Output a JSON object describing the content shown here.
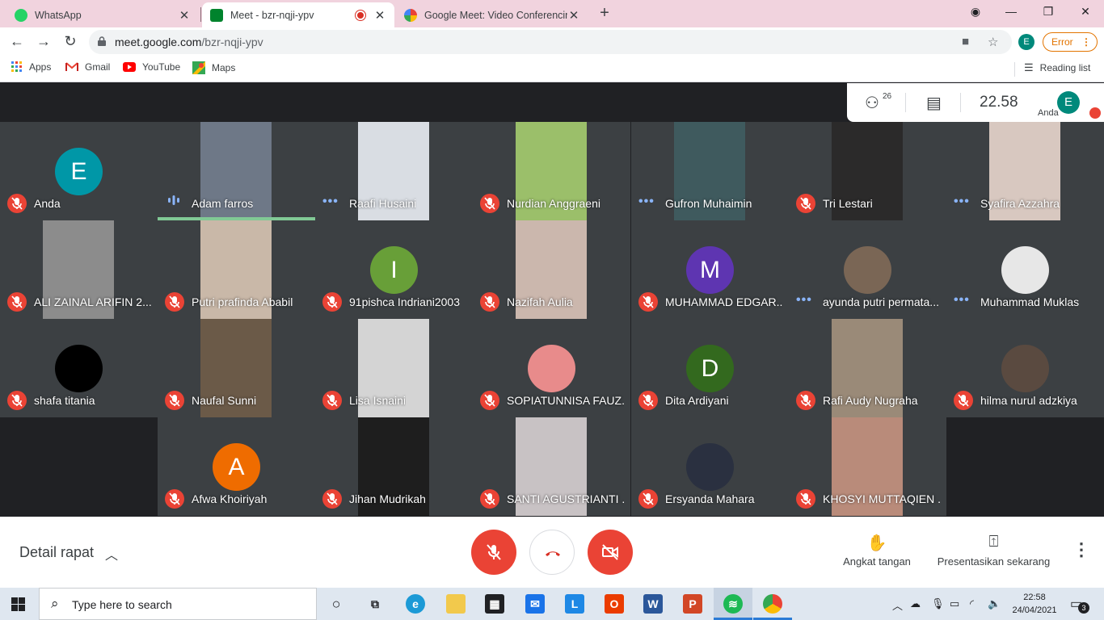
{
  "browser": {
    "tabs": [
      {
        "title": "WhatsApp",
        "favicon": "whatsapp-icon",
        "active": false
      },
      {
        "title": "Meet - bzr-nqji-ypv",
        "favicon": "google-meet-icon",
        "active": true
      },
      {
        "title": "Google Meet: Video Conferencin",
        "favicon": "google-icon",
        "active": false
      }
    ],
    "url_host": "meet.google.com",
    "url_path": "/bzr-nqji-ypv",
    "profile_initial": "E",
    "error_label": "Error",
    "bookmarks": [
      {
        "label": "Apps",
        "icon": "apps-grid-icon"
      },
      {
        "label": "Gmail",
        "icon": "gmail-icon"
      },
      {
        "label": "YouTube",
        "icon": "youtube-icon"
      },
      {
        "label": "Maps",
        "icon": "maps-icon"
      }
    ],
    "reading_list_label": "Reading list"
  },
  "meet": {
    "participant_count": "26",
    "time": "22.58",
    "self_name": "Anda",
    "self_initial": "E",
    "participants": [
      {
        "name": "Anda",
        "status": "muted",
        "avatar": {
          "initial": "E",
          "color": "#0097a7"
        }
      },
      {
        "name": "Adam farros",
        "status": "speaking",
        "video": "#6e7887"
      },
      {
        "name": "Raafi Husaini",
        "status": "active",
        "video": "#d9dde3"
      },
      {
        "name": "Nurdian Anggraeni",
        "status": "muted",
        "video": "#9bbf6a"
      },
      {
        "name": "Gufron Muhaimin",
        "status": "active",
        "video": "#3f5a5e"
      },
      {
        "name": "Tri Lestari",
        "status": "muted",
        "video": "#2b2a2a"
      },
      {
        "name": "Syafira Azzahra",
        "status": "active",
        "video": "#d8c8c0"
      },
      {
        "name": "ALI ZAINAL ARIFIN 2...",
        "status": "muted",
        "video": "#8c8c8c"
      },
      {
        "name": "Putri prafinda Ababil",
        "status": "muted",
        "video": "#c9b8a8"
      },
      {
        "name": "91pishca Indriani2003",
        "status": "muted",
        "avatar": {
          "initial": "I",
          "color": "#689f38"
        }
      },
      {
        "name": "Nazifah Aulia",
        "status": "muted",
        "video": "#cbb7ad"
      },
      {
        "name": "MUHAMMAD EDGAR...",
        "status": "muted",
        "avatar": {
          "initial": "M",
          "color": "#5e35b1"
        }
      },
      {
        "name": "ayunda putri permata...",
        "status": "active",
        "photo": "#7a6655"
      },
      {
        "name": "Muhammad Muklas",
        "status": "active",
        "photo": "#e7e7e7"
      },
      {
        "name": "shafa titania",
        "status": "muted",
        "photo": "#000000"
      },
      {
        "name": "Naufal Sunni",
        "status": "muted",
        "video": "#6b5a48"
      },
      {
        "name": "Lisa Isnaini",
        "status": "muted",
        "video": "#d4d4d4"
      },
      {
        "name": "SOPIATUNNISA FAUZ...",
        "status": "muted",
        "photo": "#e88b8b"
      },
      {
        "name": "Dita Ardiyani",
        "status": "muted",
        "avatar": {
          "initial": "D",
          "color": "#33691e"
        }
      },
      {
        "name": "Rafi Audy Nugraha",
        "status": "muted",
        "video": "#9a8a78"
      },
      {
        "name": "hilma nurul adzkiya",
        "status": "muted",
        "photo": "#5a4a40"
      },
      {
        "name": "",
        "status": "empty"
      },
      {
        "name": "Afwa Khoiriyah",
        "status": "muted",
        "avatar": {
          "initial": "A",
          "color": "#ef6c00"
        }
      },
      {
        "name": "Jihan Mudrikah",
        "status": "muted",
        "video": "#1e1e1e"
      },
      {
        "name": "SANTI AGUSTRIANTI ...",
        "status": "muted",
        "video": "#c8c2c4"
      },
      {
        "name": "Ersyanda Mahara",
        "status": "muted",
        "photo": "#2a3040"
      },
      {
        "name": "KHOSYI MUTTAQIEN ...",
        "status": "muted",
        "video": "#b98b7a"
      },
      {
        "name": "",
        "status": "empty"
      }
    ],
    "details_label": "Detail rapat",
    "raise_hand_label": "Angkat tangan",
    "present_label": "Presentasikan sekarang"
  },
  "taskbar": {
    "search_placeholder": "Type here to search",
    "time": "22:58",
    "date": "24/04/2021",
    "notification_count": "3"
  }
}
